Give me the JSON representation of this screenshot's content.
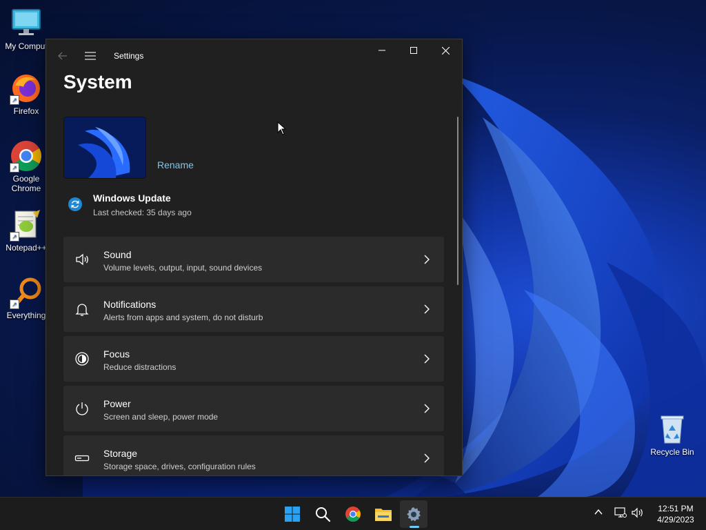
{
  "desktop": {
    "icons": [
      {
        "label": "My Comput",
        "icon": "monitor-icon"
      },
      {
        "label": "Firefox",
        "icon": "firefox-icon"
      },
      {
        "label": "Google Chrome",
        "icon": "chrome-icon"
      },
      {
        "label": "Notepad++",
        "icon": "notepad-plus-plus-icon"
      },
      {
        "label": "Everything",
        "icon": "everything-search-icon"
      },
      {
        "label": "Recycle Bin",
        "icon": "recycle-bin-icon"
      }
    ]
  },
  "window": {
    "title": "Settings",
    "page_title": "System",
    "rename_label": "Rename",
    "windows_update": {
      "title": "Windows Update",
      "subtitle": "Last checked: 35 days ago"
    },
    "cards": [
      {
        "title": "Sound",
        "subtitle": "Volume levels, output, input, sound devices",
        "icon": "speaker-icon"
      },
      {
        "title": "Notifications",
        "subtitle": "Alerts from apps and system, do not disturb",
        "icon": "bell-icon"
      },
      {
        "title": "Focus",
        "subtitle": "Reduce distractions",
        "icon": "focus-icon"
      },
      {
        "title": "Power",
        "subtitle": "Screen and sleep, power mode",
        "icon": "power-icon"
      },
      {
        "title": "Storage",
        "subtitle": "Storage space, drives, configuration rules",
        "icon": "storage-drive-icon"
      }
    ]
  },
  "taskbar": {
    "apps": [
      "start-icon",
      "search-icon",
      "chrome-icon",
      "file-explorer-icon",
      "settings-gear-icon"
    ],
    "active_app": "settings-gear-icon",
    "tray": [
      "chevron-up-icon",
      "network-icon",
      "volume-icon"
    ],
    "time": "12:51 PM",
    "date": "4/29/2023"
  },
  "colors": {
    "accent": "#78c8f0",
    "window_bg": "#202020",
    "card_bg": "#2b2b2b",
    "taskbar_bg": "#1c1c1c"
  }
}
